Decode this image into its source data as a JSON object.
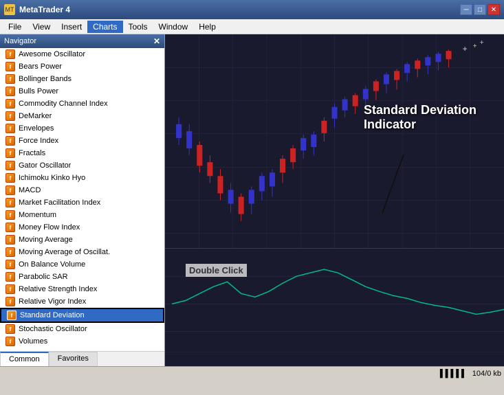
{
  "titleBar": {
    "title": "MetaTrader 4",
    "controls": [
      "minimize",
      "restore",
      "close"
    ]
  },
  "menuBar": {
    "items": [
      "File",
      "View",
      "Insert",
      "Charts",
      "Tools",
      "Window",
      "Help"
    ],
    "active": "Charts"
  },
  "navigator": {
    "title": "Navigator",
    "indicators": [
      "Awesome Oscillator",
      "Bears Power",
      "Bollinger Bands",
      "Bulls Power",
      "Commodity Channel Index",
      "DeMarker",
      "Envelopes",
      "Force Index",
      "Fractals",
      "Gator Oscillator",
      "Ichimoku Kinko Hyo",
      "MACD",
      "Market Facilitation Index",
      "Momentum",
      "Money Flow Index",
      "Moving Average",
      "Moving Average of Oscillat.",
      "On Balance Volume",
      "Parabolic SAR",
      "Relative Strength Index",
      "Relative Vigor Index",
      "Standard Deviation",
      "Stochastic Oscillator",
      "Volumes"
    ],
    "selected": "Standard Deviation",
    "tabs": [
      "Common",
      "Favorites"
    ]
  },
  "chart": {
    "annotation": {
      "title": "Standard Deviation",
      "subtitle": "Indicator",
      "doubleClick": "Double Click"
    }
  },
  "statusBar": {
    "indicator": "▌▌▌▌▌",
    "memory": "104/0 kb"
  }
}
